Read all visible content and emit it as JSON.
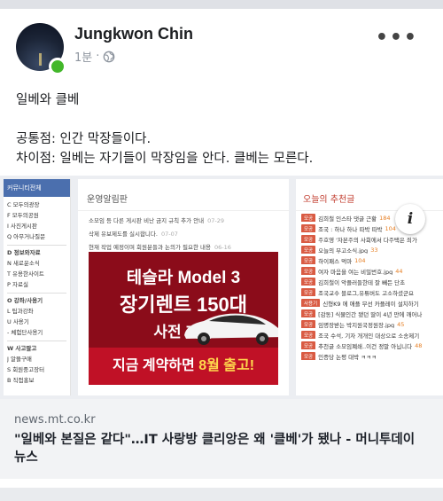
{
  "post": {
    "author": "Jungkwon Chin",
    "time": "1분",
    "privacy_separator": "·",
    "more_label": "•••",
    "text_lines": [
      "일베와 클베",
      "",
      "공통점: 인간 막장들이다.",
      "차이점: 일베는 자기들이 막장임을 안다. 클베는 모른다."
    ]
  },
  "link": {
    "domain": "news.mt.co.kr",
    "headline": "\"일베와 본질은 같다\"…IT 사랑방 클리앙은 왜 '클베'가 됐나 - 머니투데이 뉴스",
    "info_label": "i"
  },
  "preview": {
    "left_header": "커뮤니티전체",
    "left_items": [
      {
        "label": "C  모두의광장",
        "section": false
      },
      {
        "label": "F  모두의공원",
        "section": false
      },
      {
        "label": "I   사진게시판",
        "section": false
      },
      {
        "label": "Q  아무거나질문",
        "section": false
      },
      {
        "label": "D  정보와자료",
        "section": true
      },
      {
        "label": "N  새로운소식",
        "section": false
      },
      {
        "label": "T  유용한사이트",
        "section": false
      },
      {
        "label": "P  자료실",
        "section": false
      },
      {
        "label": "O  강좌/사용기",
        "section": true
      },
      {
        "label": "L  팁과강좌",
        "section": false
      },
      {
        "label": "U  사용기",
        "section": false
      },
      {
        "label": "-  체험단사용기",
        "section": false
      },
      {
        "label": "W  사고팔고",
        "section": true
      },
      {
        "label": "J   알뜰구매",
        "section": false
      },
      {
        "label": "S  회원중고장터",
        "section": false
      },
      {
        "label": "B  직접홍보",
        "section": false
      }
    ],
    "middle_title": "운영알림판",
    "middle_rows": [
      {
        "text": "소모임 등 다른 게시판 비난 금지 규칙 추가 안내",
        "date": "07-29"
      },
      {
        "text": "삭제 유보제도를 실시합니다.",
        "date": "07-07"
      },
      {
        "text": "현재 작업 예정이며 회원분들과 논의가 필요한 내용",
        "date": "06-16"
      }
    ],
    "ad": {
      "brand": "테슬라 Model 3",
      "rent": "장기렌트 150대",
      "pre": "사전 계약",
      "bottom_prefix": "지금 계약하면 ",
      "bottom_highlight": "8월 출고!"
    },
    "right_title": "오늘의 추천글",
    "right_items": [
      {
        "tag": "모공",
        "text": "김희철 인스타 댓글 근황",
        "count": "184"
      },
      {
        "tag": "모공",
        "text": "조국 : 하나 하나 따박 따박",
        "count": "104"
      },
      {
        "tag": "모공",
        "text": "주호영 '자본주의 사회에서 다주택은 죄가",
        "count": ""
      },
      {
        "tag": "모공",
        "text": "오늘의 부고소식.jpg",
        "count": "33"
      },
      {
        "tag": "모공",
        "text": "하이패스 먹마",
        "count": "104"
      },
      {
        "tag": "모공",
        "text": "여자 마음을 여는 비밀번호.jpg",
        "count": "44"
      },
      {
        "tag": "모공",
        "text": "김희철이 악플러들한테 잘 빼든 단초",
        "count": ""
      },
      {
        "tag": "모공",
        "text": "조국교수 블로그,유튜버도 고소하셨군요",
        "count": ""
      },
      {
        "tag": "사용기",
        "text": "신형K9 에 애플 무선 카플레이 설치하기",
        "count": ""
      },
      {
        "tag": "모공",
        "text": "[감동] 식물인간 됐던 딸이 4년 만에 깨어나",
        "count": ""
      },
      {
        "tag": "모공",
        "text": "임명장받는 박지원국정원장.jpg",
        "count": "45"
      },
      {
        "tag": "모공",
        "text": "조국 수석, 기자 개개인 대상으로 소송제기",
        "count": ""
      },
      {
        "tag": "모공",
        "text": "추천글 소모임폐쇄..이건 정말 아닙니다",
        "count": "48"
      },
      {
        "tag": "모공",
        "text": "인증당 논평 대박 ㅋㅋㅋ",
        "count": ""
      }
    ]
  },
  "colors": {
    "online": "#42b72a",
    "ad_dark": "#8b0c1a",
    "ad_light": "#c01126",
    "ad_highlight": "#ffd84d",
    "tag": "#d95b43"
  },
  "icons": [
    "globe-icon",
    "more-options-icon",
    "info-icon"
  ]
}
